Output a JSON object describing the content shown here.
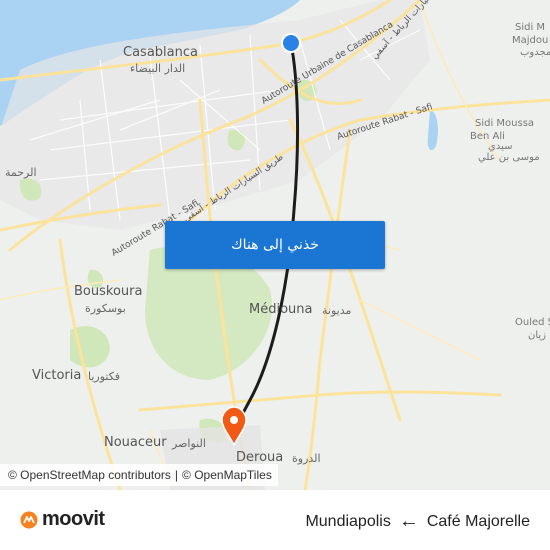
{
  "map": {
    "button_label": "خذني إلى هناك",
    "attribution": {
      "osm": "© OpenStreetMap contributors",
      "sep": "|",
      "tiles": "© OpenMapTiles"
    },
    "places": {
      "casablanca": "Casablanca",
      "casablanca_ar": "الدار البيضاء",
      "rahma_ar": "الرحمة",
      "bouskoura": "Bouskoura",
      "bouskoura_ar": "بوسكورة",
      "victoria": "Victoria",
      "victoria_ar": "فكتوريا",
      "nouaceur": "Nouaceur",
      "nouaceur_ar": "النواصر",
      "mediouna": "Médiouna",
      "mediouna_ar": "مديونة",
      "deroua": "Deroua",
      "deroua_ar": "الدروة",
      "sidi_moussa": "Sidi Moussa",
      "sidi_moussa_2": "Ben Ali",
      "sidi_moussa_ar": "سيدي",
      "sidi_moussa_ar2": "موسى بن علي",
      "sidi_majdoub": "Sidi M",
      "sidi_majdoub_2": "Majdou",
      "sidi_majdoub_ar": "مجدوب",
      "ouled": "Ouled S",
      "ouled_ar": "زيان"
    },
    "roads": {
      "urbaine": "Autoroute Urbaine de Casablanca",
      "rabat_safi_1": "Autoroute Rabat - Safi",
      "rabat_safi_2": "Autoroute Rabat - Safi",
      "ar_1": "طريق السيارات الرباط - آسفي",
      "ar_2": "طريق السيارات الرباط - آسفي"
    },
    "colors": {
      "sea": "#aad3f3",
      "land": "#eef0ee",
      "park": "#cfe7b9",
      "road": "#fce39b",
      "route": "#1c1c1c",
      "origin": "#2a82e6",
      "destination": "#f05a14"
    }
  },
  "footer": {
    "brand": "moovit",
    "destination": "Mundiapolis",
    "arrow": "←",
    "origin": "Café Majorelle"
  }
}
